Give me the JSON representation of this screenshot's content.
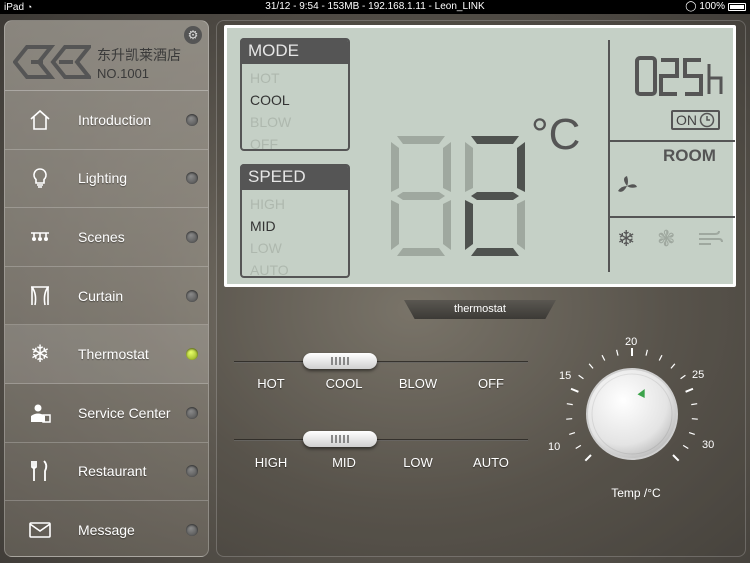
{
  "status_bar": {
    "carrier": "iPad",
    "center": "31/12 - 9:54 - 153MB - 192.168.1.11 - Leon_LINK",
    "battery": "100%"
  },
  "brand": {
    "name_cn": "东升凯莱酒店",
    "room_no": "NO.1001"
  },
  "sidebar": {
    "items": [
      {
        "label": "Introduction",
        "icon": "home-icon",
        "active": false
      },
      {
        "label": "Lighting",
        "icon": "bulb-icon",
        "active": false
      },
      {
        "label": "Scenes",
        "icon": "chandelier-icon",
        "active": false
      },
      {
        "label": "Curtain",
        "icon": "curtain-icon",
        "active": false
      },
      {
        "label": "Thermostat",
        "icon": "snowflake-icon",
        "active": true
      },
      {
        "label": "Service Center",
        "icon": "service-icon",
        "active": false
      },
      {
        "label": "Restaurant",
        "icon": "fork-knife-icon",
        "active": false
      },
      {
        "label": "Message",
        "icon": "envelope-icon",
        "active": false
      }
    ]
  },
  "lcd": {
    "mode_title": "MODE",
    "mode_options": [
      "HOT",
      "COOL",
      "BLOW",
      "OFF"
    ],
    "mode_selected": "COOL",
    "speed_title": "SPEED",
    "speed_options": [
      "HIGH",
      "MID",
      "LOW",
      "AUTO"
    ],
    "speed_selected": "MID",
    "temperature_display": "88",
    "unit": "°C",
    "timer_display": "025h",
    "on_label": "ON",
    "room_label": "ROOM"
  },
  "panel_tag": "thermostat",
  "mode_slider": {
    "labels": [
      "HOT",
      "COOL",
      "BLOW",
      "OFF"
    ],
    "selected_index": 1
  },
  "speed_slider": {
    "labels": [
      "HIGH",
      "MID",
      "LOW",
      "AUTO"
    ],
    "selected_index": 1
  },
  "dial": {
    "tick_labels": [
      "10",
      "15",
      "20",
      "25",
      "30"
    ],
    "min": 10,
    "max": 30,
    "value": 22,
    "caption": "Temp /°C"
  },
  "colors": {
    "lcd_bg": "#c5d0c6",
    "lcd_ink": "#555555",
    "active_dot": "#c8e030"
  }
}
